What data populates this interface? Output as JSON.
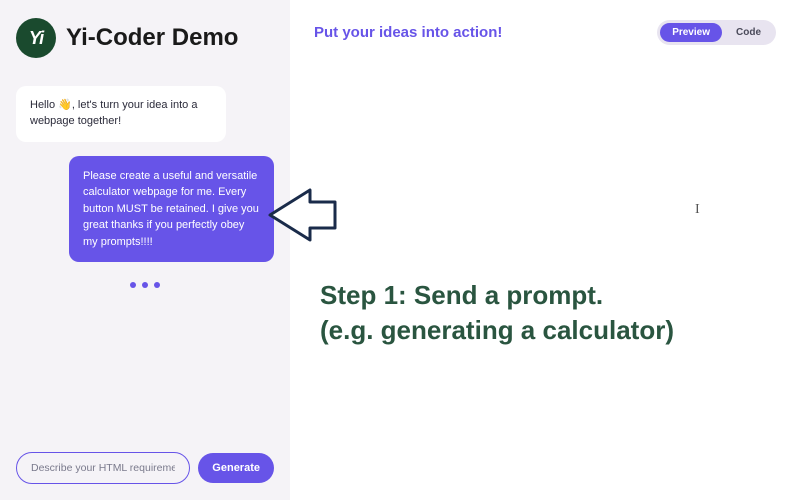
{
  "app": {
    "logo_text": "Yi",
    "title": "Yi-Coder Demo"
  },
  "chat": {
    "bot_msg": "Hello 👋, let's turn your idea into a webpage together!",
    "user_msg": "Please create a useful and versatile calculator webpage for me. Every button MUST be retained. I give you great thanks if you perfectly obey my prompts!!!!"
  },
  "input": {
    "placeholder": "Describe your HTML requirement",
    "generate_label": "Generate"
  },
  "right": {
    "hero": "Put your ideas into action!",
    "toggle": {
      "preview": "Preview",
      "code": "Code"
    }
  },
  "overlay": {
    "step_line1": "Step 1: Send a prompt.",
    "step_line2": "(e.g. generating a calculator)"
  }
}
